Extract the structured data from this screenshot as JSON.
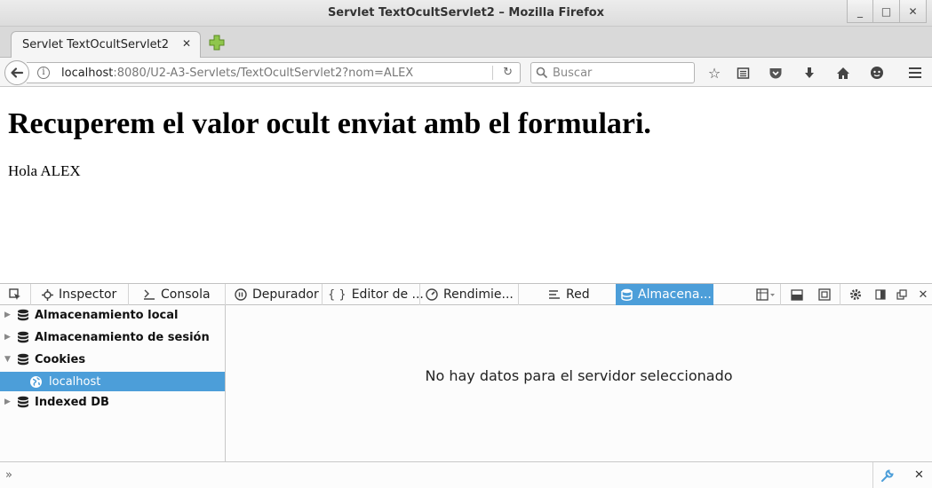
{
  "window": {
    "title": "Servlet TextOcultServlet2 – Mozilla Firefox",
    "controls": [
      "_",
      "□",
      "✕"
    ]
  },
  "tab": {
    "label": "Servlet TextOcultServlet2",
    "close": "✕"
  },
  "navbar": {
    "url_host": "localhost",
    "url_rest": ":8080/U2-A3-Servlets/TextOcultServlet2?nom=ALEX",
    "search_placeholder": "Buscar",
    "icons": [
      "star-icon",
      "reading-list-icon",
      "pocket-icon",
      "download-icon",
      "home-icon",
      "chat-icon",
      "menu-icon"
    ]
  },
  "page": {
    "heading": "Recuperem el valor ocult enviat amb el formulari.",
    "text": "Hola ALEX"
  },
  "devtools": {
    "tabs": [
      "Inspector",
      "Consola",
      "Depurador",
      "Editor de ...",
      "Rendimie...",
      "Red",
      "Almacena..."
    ],
    "active_tab": "Almacena...",
    "accent": "#4c9ed9"
  },
  "storage_tree": {
    "items": [
      {
        "label": "Almacenamiento local",
        "expanded": false
      },
      {
        "label": "Almacenamiento de sesión",
        "expanded": false
      },
      {
        "label": "Cookies",
        "expanded": true
      },
      {
        "label": "localhost",
        "selected": true
      },
      {
        "label": "Indexed DB",
        "expanded": false
      }
    ]
  },
  "main": {
    "message": "No hay datos para el servidor seleccionado"
  },
  "console": {
    "prompt": "»"
  }
}
